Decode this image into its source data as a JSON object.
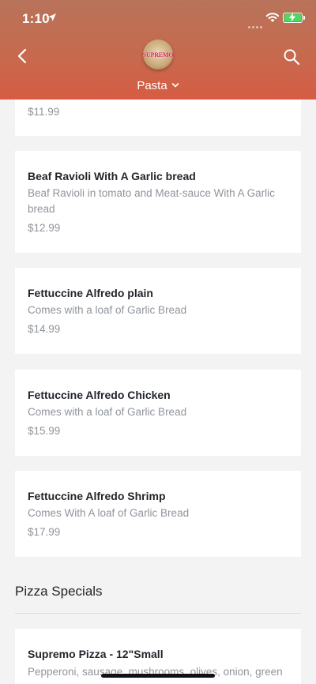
{
  "status_bar": {
    "time": "1:10"
  },
  "header": {
    "logo_text": "SUPREMO",
    "category": "Pasta"
  },
  "menu": {
    "partial_item": {
      "price": "$11.99"
    },
    "items": [
      {
        "name": "Beaf Ravioli With A Garlic bread",
        "description": "Beaf Ravioli in tomato and Meat-sauce  With A Garlic bread",
        "price": "$12.99"
      },
      {
        "name": "Fettuccine Alfredo plain",
        "description": "Comes with a loaf of Garlic Bread",
        "price": "$14.99"
      },
      {
        "name": "Fettuccine Alfredo Chicken",
        "description": "Comes with a loaf of Garlic Bread",
        "price": "$15.99"
      },
      {
        "name": "Fettuccine Alfredo Shrimp",
        "description": "Comes With A loaf of Garlic Bread",
        "price": "$17.99"
      }
    ],
    "next_section": {
      "title": "Pizza Specials",
      "first_item": {
        "name": "Supremo Pizza - 12\"Small",
        "description": "Pepperoni, sausage, mushrooms, olives, onion, green"
      }
    }
  }
}
